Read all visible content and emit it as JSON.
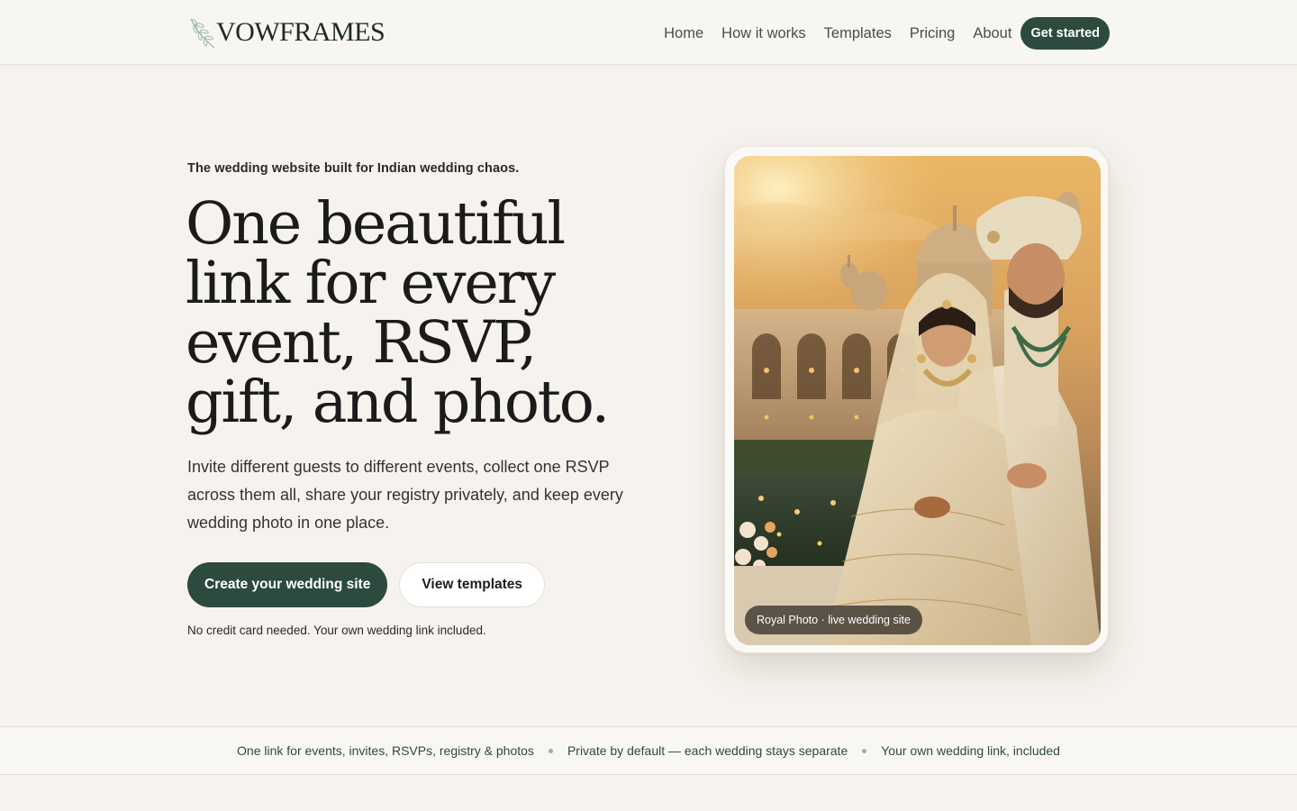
{
  "brand": {
    "name": "VOWFRAMES",
    "logo_icon": "leaf-sprig-icon"
  },
  "nav": {
    "links": [
      "Home",
      "How it works",
      "Templates",
      "Pricing",
      "About"
    ],
    "cta_label": "Get started"
  },
  "hero": {
    "eyebrow": "The wedding website built for Indian wedding chaos.",
    "title_lines": [
      "One beautiful",
      "link for every",
      "event, RSVP,",
      "gift, and photo."
    ],
    "body": "Invite different guests to different events, collect one RSVP across them all, share your registry privately, and keep every wedding photo in one place.",
    "primary_cta": "Create your wedding site",
    "secondary_cta": "View templates",
    "fine_print": "No credit card needed. Your own wedding link included.",
    "photo_badge": "Royal Photo · live wedding site"
  },
  "trust_strip": {
    "items": [
      "One link for events, invites, RSVPs, registry & photos",
      "Private by default — each wedding stays separate",
      "Your own wedding link, included"
    ]
  },
  "colors": {
    "accent": "#2c4a3e",
    "background": "#f6f3ee",
    "bullet": "#93b39f"
  }
}
